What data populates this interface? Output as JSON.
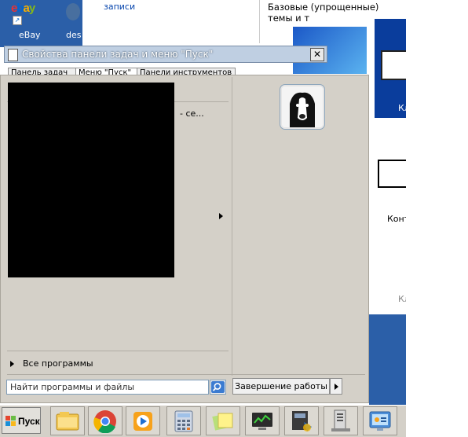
{
  "desktop": {
    "icons": [
      {
        "label": "eBay"
      },
      {
        "label": "des"
      }
    ]
  },
  "background_window": {
    "left_text": "записи",
    "right_text": "Базовые (упрощенные) темы и т",
    "thumb_label_1": "Кл",
    "thumb_label_2": "Конт",
    "thumb_label_3": "Кл"
  },
  "dialog": {
    "title": "Свойства панели задач и меню \"Пуск\"",
    "close_label": "✕",
    "tabs": [
      {
        "label": "Панель задач"
      },
      {
        "label": "Меню \"Пуск\""
      },
      {
        "label": "Панели инструментов"
      }
    ]
  },
  "start_menu": {
    "partial_item_text": "- се...",
    "all_programs": "Все программы",
    "search_placeholder": "Найти программы и файлы",
    "shutdown_label": "Завершение работы"
  },
  "taskbar": {
    "start_label": "Пуск",
    "buttons": [
      {
        "icon": "explorer-icon"
      },
      {
        "icon": "chrome-icon"
      },
      {
        "icon": "media-player-icon"
      },
      {
        "icon": "calculator-icon"
      },
      {
        "icon": "sticky-notes-icon"
      },
      {
        "icon": "network-monitor-icon"
      },
      {
        "icon": "system-tool-icon"
      },
      {
        "icon": "server-icon"
      },
      {
        "icon": "control-panel-icon"
      }
    ]
  },
  "colors": {
    "desktop_blue": "#2b5fa8",
    "menu_gray": "#d4d0c8",
    "taskbar_gray": "#d4d0c8"
  }
}
